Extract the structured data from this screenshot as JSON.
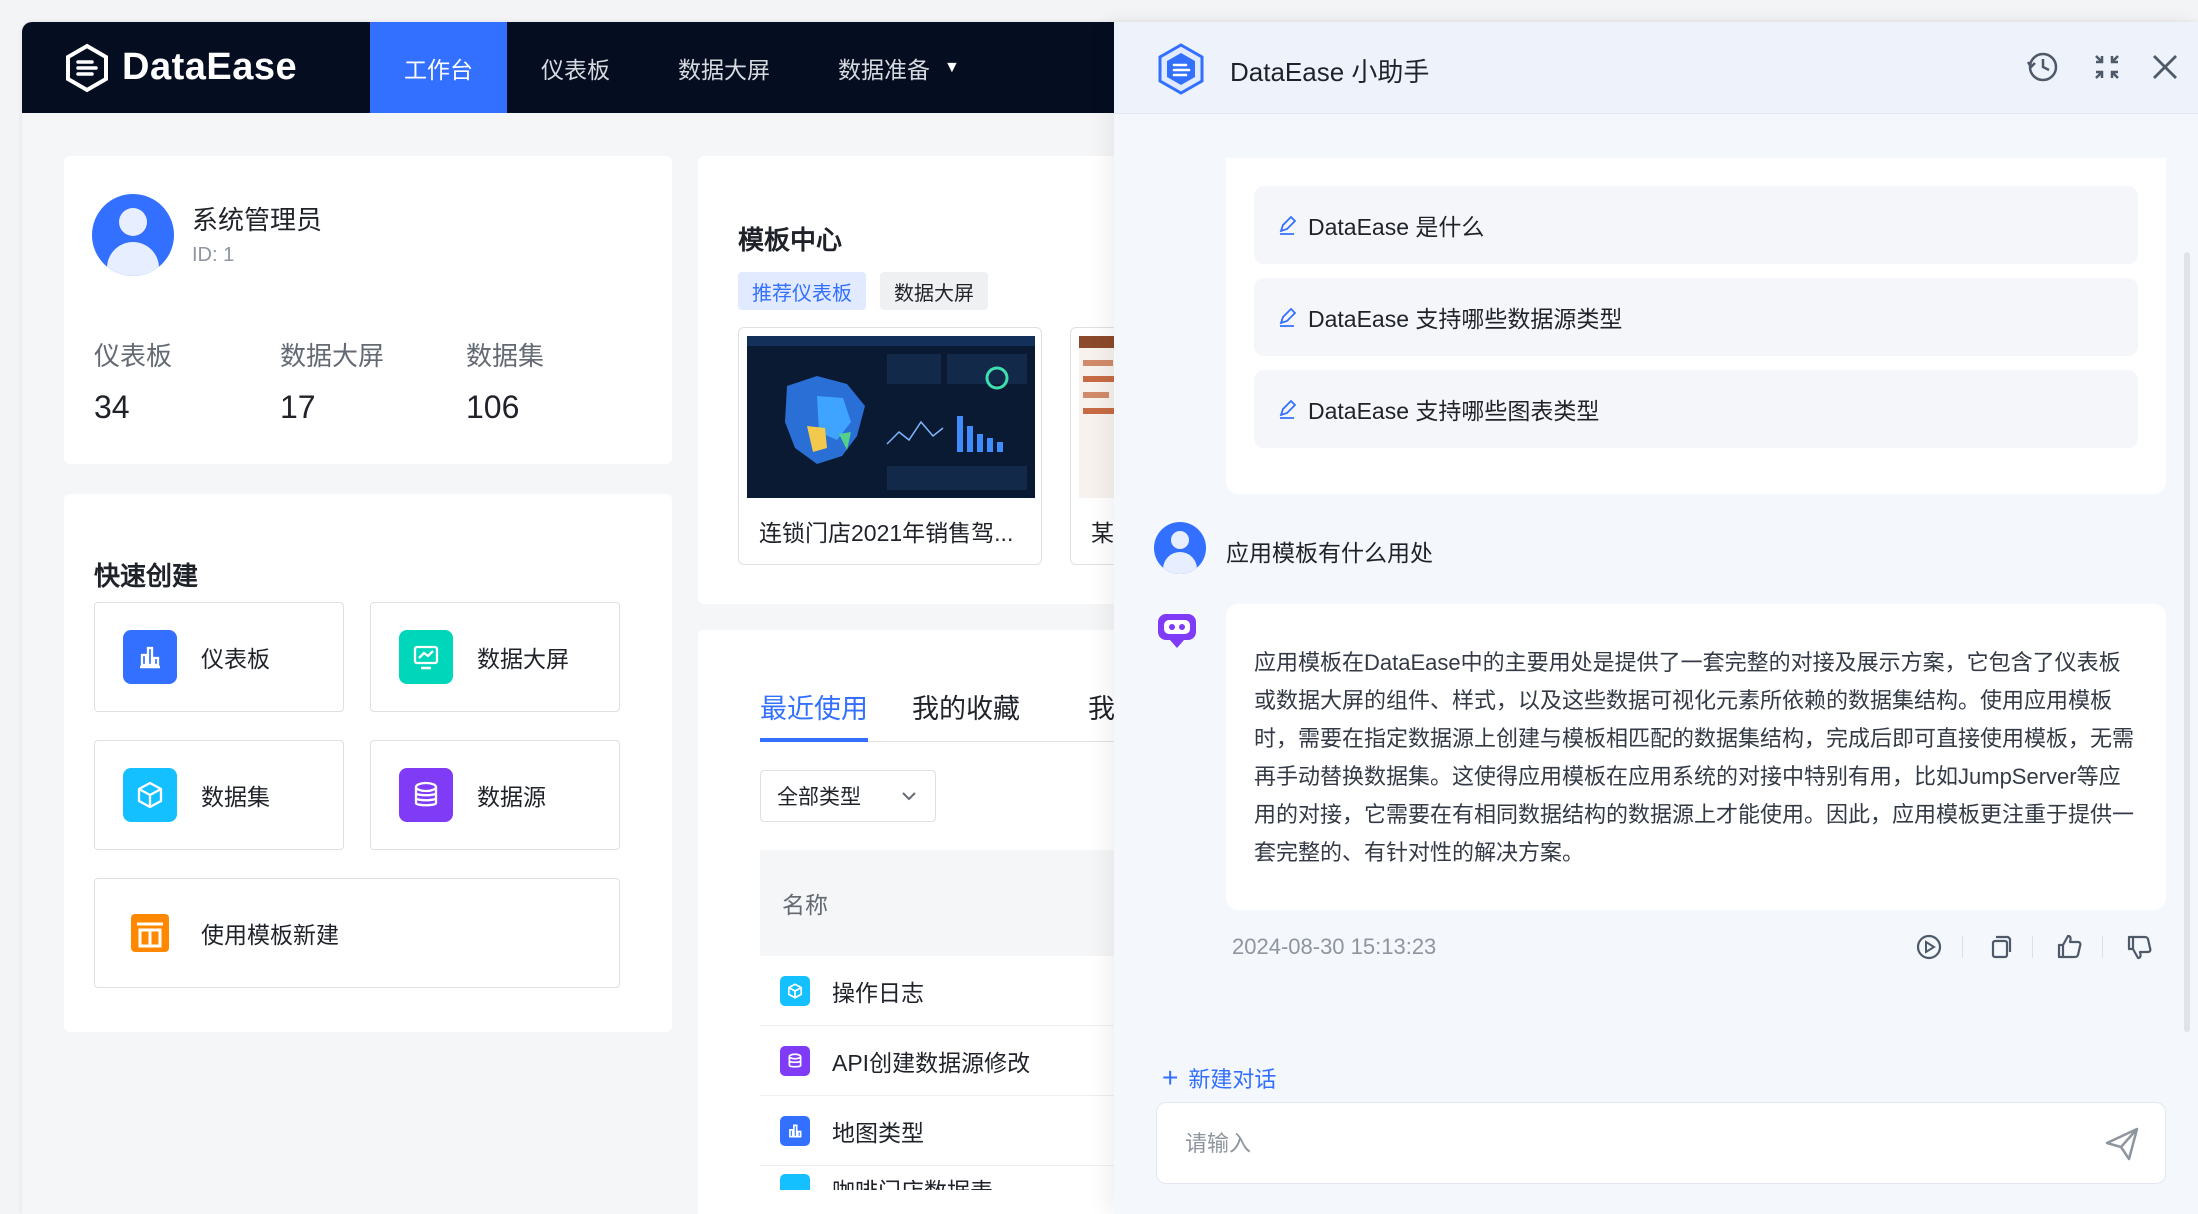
{
  "brand": {
    "name": "DataEase"
  },
  "topnav": {
    "items": [
      {
        "label": "工作台",
        "active": true
      },
      {
        "label": "仪表板"
      },
      {
        "label": "数据大屏"
      },
      {
        "label": "数据准备"
      }
    ]
  },
  "user": {
    "name": "系统管理员",
    "id": "ID: 1",
    "stats": [
      {
        "label": "仪表板",
        "value": "34"
      },
      {
        "label": "数据大屏",
        "value": "17"
      },
      {
        "label": "数据集",
        "value": "106"
      }
    ]
  },
  "quick_create": {
    "title": "快速创建",
    "items": [
      {
        "label": "仪表板",
        "icon": "bar-chart-icon",
        "color": "#3370ff"
      },
      {
        "label": "数据大屏",
        "icon": "monitor-chart-icon",
        "color": "#00d6b9"
      },
      {
        "label": "数据集",
        "icon": "cube-icon",
        "color": "#14c0ff"
      },
      {
        "label": "数据源",
        "icon": "database-icon",
        "color": "#7f3bf5"
      },
      {
        "label": "使用模板新建",
        "icon": "template-icon",
        "color": "#ff8800"
      }
    ]
  },
  "templates": {
    "title": "模板中心",
    "chips": [
      "推荐仪表板",
      "数据大屏"
    ],
    "cards": [
      {
        "title": "连锁门店2021年销售驾..."
      },
      {
        "title": "某"
      }
    ]
  },
  "recent": {
    "tabs": [
      "最近使用",
      "我的收藏",
      "我"
    ],
    "filter": "全部类型",
    "column_name": "名称",
    "rows": [
      {
        "name": "操作日志",
        "icon": "cube-icon",
        "color": "#14c0ff"
      },
      {
        "name": "API创建数据源修改",
        "icon": "database-icon",
        "color": "#7f3bf5"
      },
      {
        "name": "地图类型",
        "icon": "bar-chart-icon",
        "color": "#3370ff"
      },
      {
        "name": "咖啡门店数据表",
        "icon": "cube-icon",
        "color": "#14c0ff"
      }
    ]
  },
  "assistant": {
    "title": "DataEase 小助手",
    "suggestions": [
      "DataEase 是什么",
      "DataEase 支持哪些数据源类型",
      "DataEase 支持哪些图表类型"
    ],
    "question": "应用模板有什么用处",
    "answer": "应用模板在DataEase中的主要用处是提供了一套完整的对接及展示方案，它包含了仪表板或数据大屏的组件、样式，以及这些数据可视化元素所依赖的数据集结构。使用应用模板时，需要在指定数据源上创建与模板相匹配的数据集结构，完成后即可直接使用模板，无需再手动替换数据集。这使得应用模板在应用系统的对接中特别有用，比如JumpServer等应用的对接，它需要在有相同数据结构的数据源上才能使用。因此，应用模板更注重于提供一套完整的、有针对性的解决方案。",
    "timestamp": "2024-08-30 15:13:23",
    "new_chat": "新建对话",
    "input_placeholder": "请输入"
  }
}
